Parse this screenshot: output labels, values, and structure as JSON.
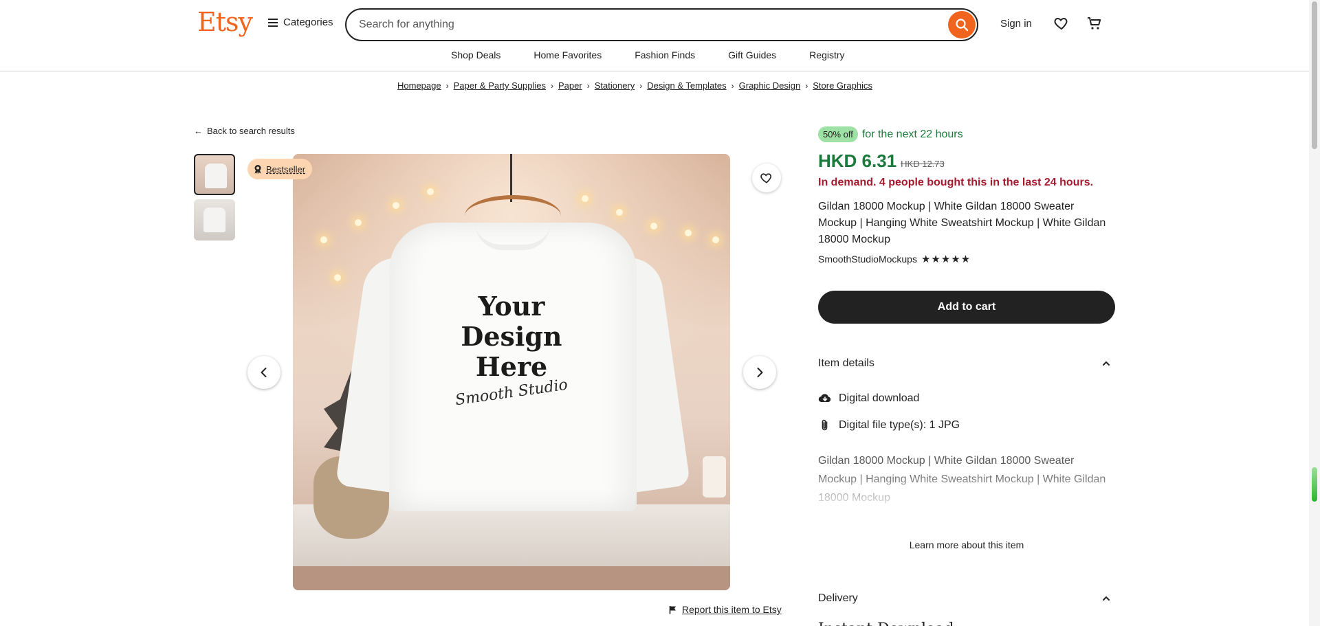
{
  "header": {
    "logo": "Etsy",
    "categories_label": "Categories",
    "search_placeholder": "Search for anything",
    "signin_label": "Sign in",
    "nav": [
      "Shop Deals",
      "Home Favorites",
      "Fashion Finds",
      "Gift Guides",
      "Registry"
    ]
  },
  "breadcrumb": [
    "Homepage",
    "Paper & Party Supplies",
    "Paper",
    "Stationery",
    "Design & Templates",
    "Graphic Design",
    "Store Graphics"
  ],
  "back_link": "Back to search results",
  "gallery": {
    "badge": "Bestseller",
    "image_text_lines": [
      "Your",
      "Design",
      "Here"
    ],
    "image_script": "Smooth Studio",
    "thumbnail_count": 2,
    "active_thumbnail": 1
  },
  "report_link": "Report this item to Etsy",
  "product": {
    "sale_badge": "50% off",
    "sale_text": "for the next 22 hours",
    "price": "HKD 6.31",
    "original_price": "HKD 12.73",
    "demand": "In demand. 4 people bought this in the last 24 hours.",
    "title": "Gildan 18000 Mockup | White Gildan 18000 Sweater Mockup | Hanging White Sweatshirt Mockup | White Gildan 18000 Mockup",
    "shop_name": "SmoothStudioMockups",
    "rating_stars": "★★★★★",
    "add_to_cart": "Add to cart"
  },
  "item_details": {
    "header": "Item details",
    "digital_download": "Digital download",
    "file_types": "Digital file type(s): 1 JPG",
    "description": "Gildan 18000 Mockup | White Gildan 18000 Sweater Mockup | Hanging White Sweatshirt Mockup | White Gildan 18000 Mockup",
    "learn_more": "Learn more about this item"
  },
  "delivery": {
    "header": "Delivery",
    "instant_download": "Instant Download"
  },
  "colors": {
    "brand": "#f1641e",
    "price_green": "#1a7a3b",
    "demand_red": "#a61a2e",
    "sale_badge_bg": "#9ee1a5",
    "bestseller_bg": "#fdd5b1"
  }
}
